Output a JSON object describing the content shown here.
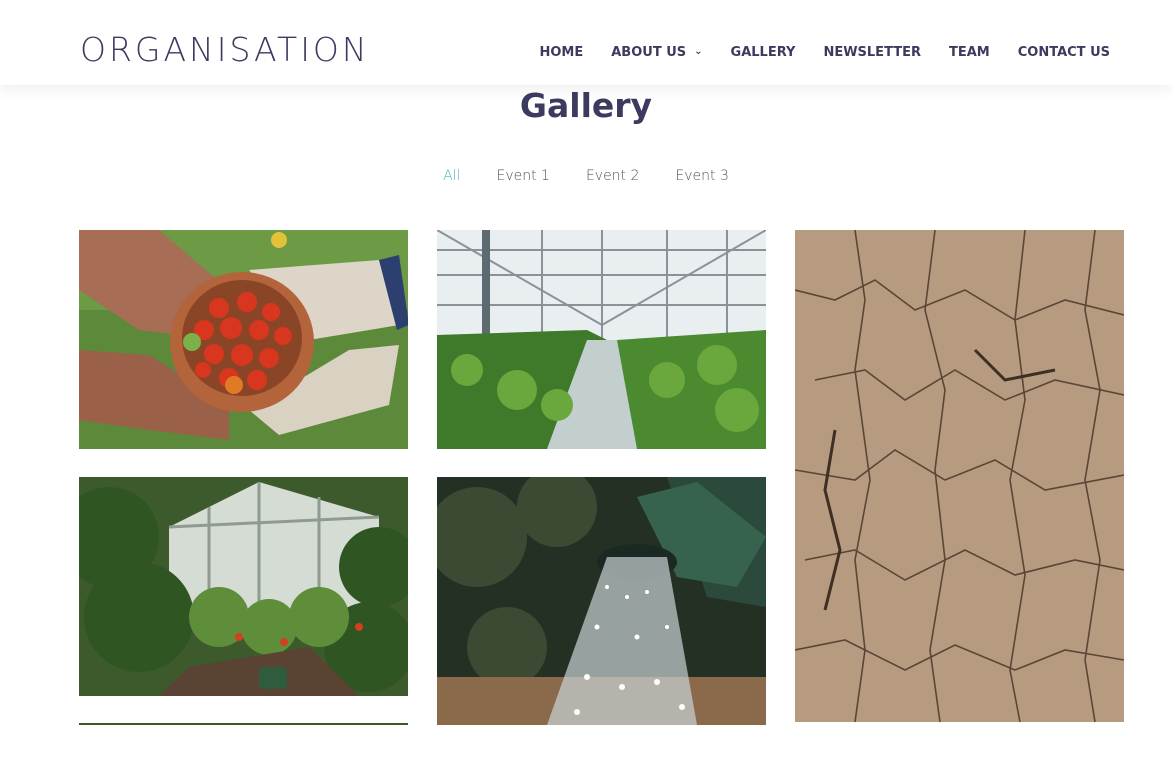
{
  "header": {
    "logo": "ORGANISATION",
    "nav": [
      {
        "label": "HOME"
      },
      {
        "label": "ABOUT US",
        "dropdown": true
      },
      {
        "label": "GALLERY"
      },
      {
        "label": "NEWSLETTER"
      },
      {
        "label": "TEAM"
      },
      {
        "label": "CONTACT US"
      }
    ]
  },
  "gallery": {
    "title": "Gallery",
    "filters": [
      "All",
      "Event 1",
      "Event 2",
      "Event 3"
    ],
    "active_filter": "All",
    "images": [
      {
        "subject": "hands holding bowl of cherry tomatoes"
      },
      {
        "subject": "greenhouse rows of plants"
      },
      {
        "subject": "cracked dry soil"
      },
      {
        "subject": "inside small greenhouse with tomato plants"
      },
      {
        "subject": "watering can spraying water"
      },
      {
        "subject": "partially visible image"
      }
    ]
  },
  "colors": {
    "brand_text": "#3c3a5f",
    "active_filter": "#4fb3c9"
  }
}
